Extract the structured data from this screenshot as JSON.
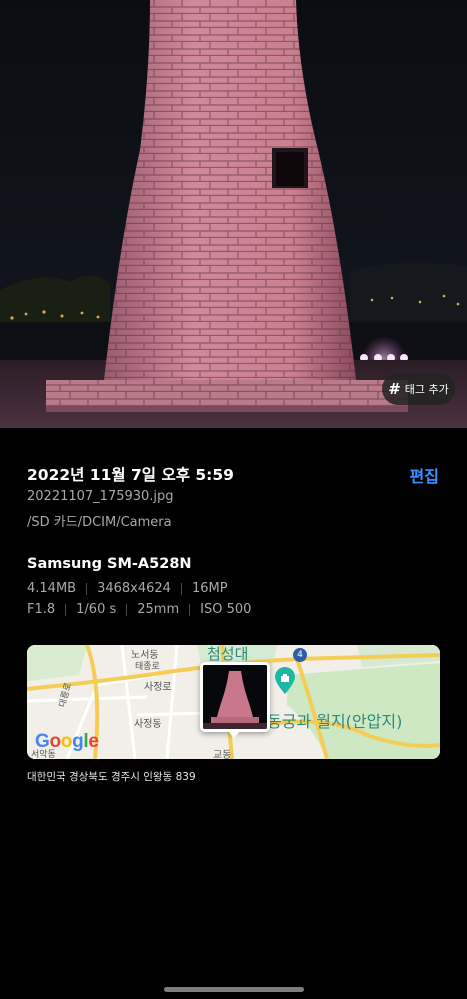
{
  "photo": {
    "tag_button": {
      "icon": "hash-icon",
      "label": "태그 추가"
    }
  },
  "details": {
    "datetime": "2022년 11월 7일 오후 5:59",
    "edit_label": "편집",
    "filename": "20221107_175930.jpg",
    "path": "/SD 카드/DCIM/Camera"
  },
  "camera": {
    "device": "Samsung SM-A528N",
    "row1": [
      "4.14MB",
      "3468x4624",
      "16MP"
    ],
    "row2": [
      "F1.8",
      "1/60 s",
      "25mm",
      "ISO 500"
    ]
  },
  "map": {
    "labels": {
      "noseo": "노서동",
      "taejongro": "태종로",
      "sajeong1": "사정로",
      "sajeong2": "사정동",
      "daereungro": "대릉로",
      "seoakdong": "서악동",
      "gyodong": "교동",
      "route4": "4",
      "cheomseongdae": "첨성대",
      "palace": "동궁과 월지(안압지)"
    },
    "google": [
      "G",
      "o",
      "o",
      "g",
      "l",
      "e"
    ],
    "google_colors": [
      "#4285F4",
      "#EA4335",
      "#FBBC05",
      "#4285F4",
      "#34A853",
      "#EA4335"
    ]
  },
  "address": "대한민국 경상북도 경주시 인왕동 839"
}
